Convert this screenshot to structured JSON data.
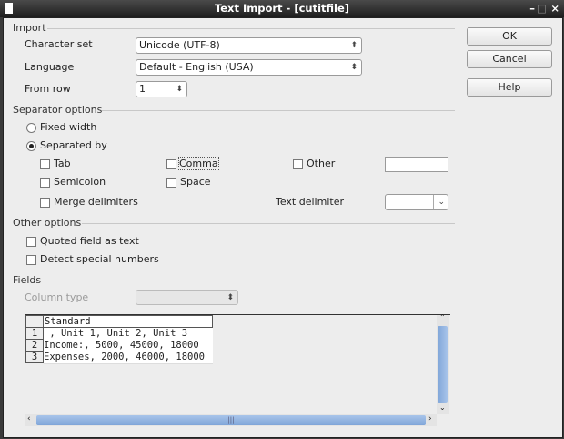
{
  "window": {
    "title": "Text Import - [cutitfile]"
  },
  "import": {
    "heading": "Import",
    "charset_label": "Character set",
    "charset_value": "Unicode (UTF-8)",
    "language_label": "Language",
    "language_value": "Default - English (USA)",
    "from_row_label": "From row",
    "from_row_value": "1"
  },
  "separator": {
    "heading": "Separator options",
    "fixed_width": "Fixed width",
    "separated_by": "Separated by",
    "tab": "Tab",
    "comma": "Comma",
    "other": "Other",
    "semicolon": "Semicolon",
    "space": "Space",
    "merge": "Merge delimiters",
    "text_delimiter": "Text delimiter",
    "selected": "separated_by"
  },
  "other_options": {
    "heading": "Other options",
    "quoted": "Quoted field as text",
    "detect": "Detect special numbers"
  },
  "fields": {
    "heading": "Fields",
    "column_type_label": "Column type",
    "column_header": "Standard",
    "rows": [
      {
        "n": "1",
        "text": " , Unit 1, Unit 2, Unit 3"
      },
      {
        "n": "2",
        "text": "Income:, 5000, 45000, 18000"
      },
      {
        "n": "3",
        "text": "Expenses, 2000, 46000, 18000"
      }
    ]
  },
  "buttons": {
    "ok": "OK",
    "cancel": "Cancel",
    "help": "Help"
  }
}
